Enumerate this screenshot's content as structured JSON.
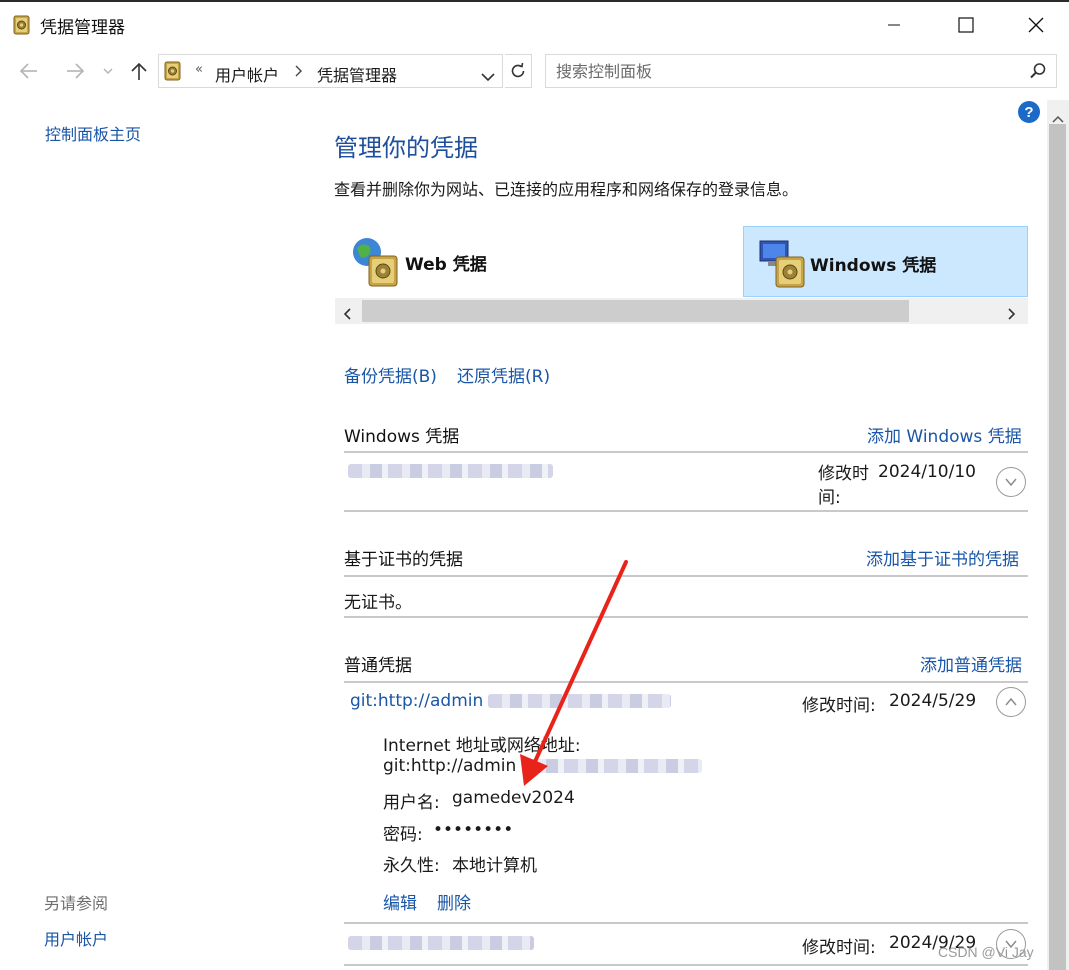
{
  "window": {
    "title": "凭据管理器"
  },
  "nav": {
    "address_overflow": "«",
    "breadcrumb": [
      "用户帐户",
      "凭据管理器"
    ],
    "search_placeholder": "搜索控制面板"
  },
  "sidebar": {
    "home_link": "控制面板主页",
    "see_also_heading": "另请参阅",
    "see_also_links": [
      "用户帐户"
    ]
  },
  "main": {
    "title": "管理你的凭据",
    "description": "查看并删除你为网站、已连接的应用程序和网络保存的登录信息。",
    "tabs": [
      {
        "label": "Web 凭据",
        "selected": false
      },
      {
        "label": "Windows 凭据",
        "selected": true
      }
    ],
    "backup_link": "备份凭据(B)",
    "restore_link": "还原凭据(R)",
    "windows_section": {
      "title": "Windows 凭据",
      "add_link": "添加 Windows 凭据",
      "items": [
        {
          "modified_label": "修改时间:",
          "modified_date": "2024/10/10"
        }
      ]
    },
    "cert_section": {
      "title": "基于证书的凭据",
      "add_link": "添加基于证书的凭据",
      "empty_text": "无证书。"
    },
    "generic_section": {
      "title": "普通凭据",
      "add_link": "添加普通凭据",
      "items": [
        {
          "name_visible": "git:http://admin",
          "modified_label": "修改时间:",
          "modified_date": "2024/5/29",
          "expanded": true,
          "details": {
            "address_label": "Internet 地址或网络地址:",
            "address_value_visible": "git:http://admin",
            "username_label": "用户名:",
            "username_value": "gamedev2024",
            "password_label": "密码:",
            "password_value": "••••••••",
            "persistence_label": "永久性:",
            "persistence_value": "本地计算机"
          },
          "actions": [
            "编辑",
            "删除"
          ]
        },
        {
          "modified_label": "修改时间:",
          "modified_date": "2024/9/29",
          "expanded": false
        }
      ]
    }
  },
  "watermark": "CSDN @Vi Jay",
  "colors": {
    "link": "#1a56a8",
    "title": "#1e4f9c",
    "tab_selected_bg": "#cce8ff",
    "annotation_arrow": "#e8231a"
  }
}
